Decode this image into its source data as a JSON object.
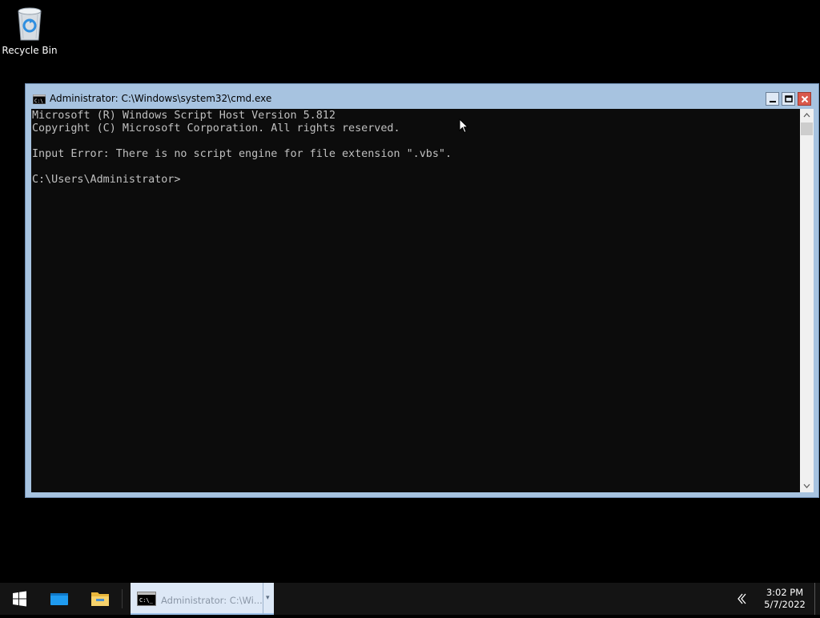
{
  "desktop": {
    "icons": [
      {
        "label": "Recycle Bin",
        "icon": "recycle-bin-icon"
      }
    ]
  },
  "window": {
    "title": "Administrator: C:\\Windows\\system32\\cmd.exe",
    "icon": "console-icon",
    "controls": {
      "minimize": "minimize-icon",
      "maximize": "maximize-icon",
      "close": "close-icon"
    },
    "console": {
      "lines": [
        "Microsoft (R) Windows Script Host Version 5.812",
        "Copyright (C) Microsoft Corporation. All rights reserved.",
        "",
        "Input Error: There is no script engine for file extension \".vbs\".",
        "",
        "C:\\Users\\Administrator>"
      ],
      "text_color": "#c0c0c0",
      "background": "#0c0c0c"
    }
  },
  "taskbar": {
    "start_icon": "windows-logo-icon",
    "pinned": [
      {
        "name": "Internet Explorer",
        "icon": "browser-icon"
      },
      {
        "name": "File Explorer",
        "icon": "folder-icon"
      }
    ],
    "active_task": {
      "label": "Administrator: C:\\Wi...",
      "icon": "console-icon"
    },
    "tray_chevron": "«",
    "clock": {
      "time": "3:02 PM",
      "date": "5/7/2022"
    }
  },
  "colors": {
    "window_frame": "#a7c3e0",
    "close_button": "#d9584b",
    "taskbar": "#141414",
    "active_task": "#dde8f6"
  }
}
